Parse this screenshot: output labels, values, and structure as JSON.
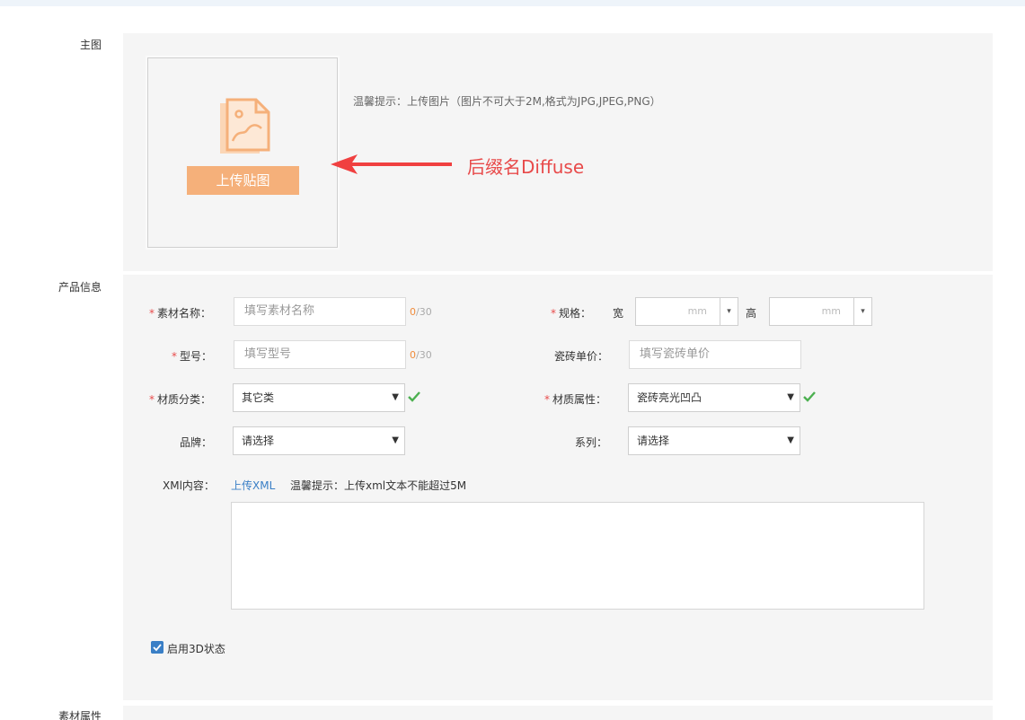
{
  "sections": {
    "main_image": "主图",
    "product_info": "产品信息",
    "material_attr": "素材属性"
  },
  "upload": {
    "button_label": "上传贴图",
    "tip": "温馨提示：上传图片（图片不可大于2M,格式为JPG,JPEG,PNG）"
  },
  "annotation": {
    "text": "后缀名Diffuse",
    "color": "#e84a4a"
  },
  "form": {
    "required_mark": "*",
    "name": {
      "label": "素材名称：",
      "placeholder": "填写素材名称",
      "count": "0",
      "max": "/30"
    },
    "model": {
      "label": "型号：",
      "placeholder": "填写型号",
      "count": "0",
      "max": "/30"
    },
    "spec": {
      "label": "规格：",
      "width_label": "宽",
      "height_label": "高",
      "unit": "mm",
      "caret": "▾"
    },
    "tile_price": {
      "label": "瓷砖单价：",
      "placeholder": "填写瓷砖单价"
    },
    "material_category": {
      "label": "材质分类：",
      "value": "其它类",
      "caret": "▼"
    },
    "material_property": {
      "label": "材质属性：",
      "value": "瓷砖亮光凹凸",
      "caret": "▼"
    },
    "brand": {
      "label": "品牌：",
      "value": "请选择",
      "caret": "▼"
    },
    "series": {
      "label": "系列：",
      "value": "请选择",
      "caret": "▼"
    },
    "xml": {
      "label": "XMl内容：",
      "link": "上传XML",
      "tip": "温馨提示：上传xml文本不能超过5M"
    },
    "enable_3d": {
      "label": "启用3D状态",
      "checked": true
    }
  },
  "colors": {
    "accent_orange": "#f5b07a",
    "link_blue": "#3a7fc6",
    "check_green": "#4cb050",
    "required_red": "#e84a4a"
  },
  "icons": {
    "upload": "image-file-icon",
    "check": "check-icon",
    "checkbox": "checkbox-checked-icon"
  }
}
